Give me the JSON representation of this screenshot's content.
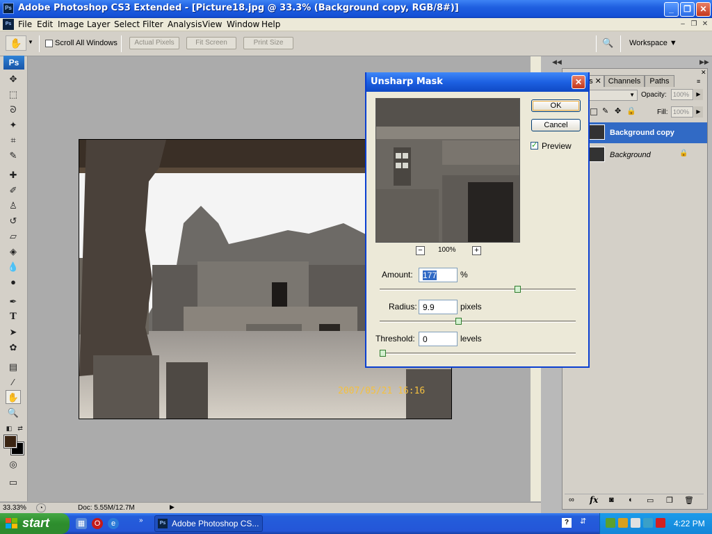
{
  "window": {
    "title": "Adobe Photoshop CS3 Extended - [Picture18.jpg @ 33.3% (Background copy, RGB/8#)]",
    "app_icon_text": "Ps",
    "minimize": "_",
    "maximize": "❐",
    "close": "✕"
  },
  "menubar": {
    "items": [
      "File",
      "Edit",
      "Image",
      "Layer",
      "Select",
      "Filter",
      "Analysis",
      "View",
      "Window",
      "Help"
    ]
  },
  "options_bar": {
    "scroll_all_windows": "Scroll All Windows",
    "actual_pixels": "Actual Pixels",
    "fit_screen": "Fit Screen",
    "print_size": "Print Size",
    "workspace": "Workspace"
  },
  "tools": {
    "logo": "Ps",
    "icons": [
      "move-tool-icon",
      "marquee-tool-icon",
      "lasso-tool-icon",
      "magic-wand-tool-icon",
      "crop-tool-icon",
      "slice-tool-icon",
      "healing-brush-icon",
      "brush-tool-icon",
      "clone-stamp-icon",
      "history-brush-icon",
      "eraser-tool-icon",
      "paint-bucket-icon",
      "blur-tool-icon",
      "dodge-tool-icon",
      "pen-tool-icon",
      "type-tool-icon",
      "path-selection-icon",
      "shape-tool-icon",
      "notes-tool-icon",
      "eyedropper-tool-icon",
      "hand-tool-icon",
      "zoom-tool-icon"
    ],
    "foreground_color": "#3a2412",
    "background_color": "#000000"
  },
  "canvas": {
    "photo_timestamp": "2007/05/21 16:16"
  },
  "statusbar": {
    "zoom": "33.33%",
    "doc": "Doc: 5.55M/12.7M"
  },
  "layers_panel": {
    "tabs": [
      "s",
      "Channels",
      "Paths"
    ],
    "opacity_label": "Opacity:",
    "opacity_value": "100%",
    "fill_label": "Fill:",
    "fill_value": "100%",
    "layers": [
      {
        "name": "Background copy",
        "selected": true
      },
      {
        "name": "Background",
        "selected": false,
        "locked": true
      }
    ]
  },
  "dialog": {
    "title": "Unsharp Mask",
    "ok": "OK",
    "cancel": "Cancel",
    "preview_label": "Preview",
    "preview_checked": true,
    "preview_zoom": "100%",
    "amount_label": "Amount:",
    "amount_value": "177",
    "amount_unit": "%",
    "amount_fraction": 0.71,
    "radius_label": "Radius:",
    "radius_value": "9.9",
    "radius_unit": "pixels",
    "radius_fraction": 0.4,
    "threshold_label": "Threshold:",
    "threshold_value": "0",
    "threshold_unit": "levels",
    "threshold_fraction": 0.0
  },
  "taskbar": {
    "start": "start",
    "task": "Adobe Photoshop CS...",
    "clock": "4:22 PM",
    "accent": "#245edb"
  }
}
